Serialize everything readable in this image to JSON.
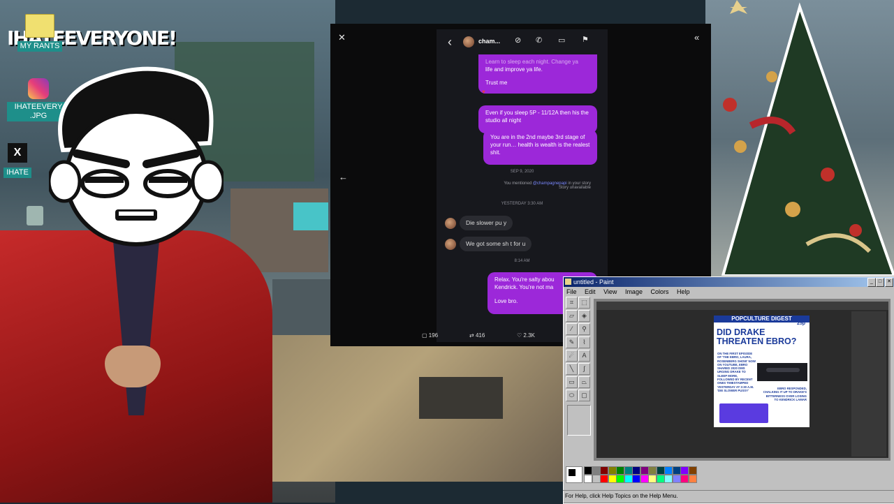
{
  "desktop": {
    "banner": "IHATEEVERYONE!",
    "icons": [
      {
        "label": "MY RANTS",
        "icon": "folder-icon"
      },
      {
        "label": "IHATEEVERY .JPG",
        "icon": "instagram-icon"
      },
      {
        "label": "IHATE",
        "icon": "x-icon"
      }
    ]
  },
  "chat": {
    "close_label": "✕",
    "collapse_label": "«",
    "back_arrow": "←",
    "header": {
      "name": "cham...",
      "back": "‹"
    },
    "messages": {
      "m1_line1": "Learn to sleep each night. Change ya",
      "m1_line2": "life and improve ya life.",
      "m1_line3": "Trust me",
      "m2": "Even if you sleep 5P - 11/12A then his the studio all night",
      "m3": "You are in the 2nd maybe 3rd stage of your run… health is wealth is the realest shit.",
      "date1": "SEP 9, 2020",
      "mention_prefix": "You mentioned",
      "mention_handle": "@champagnepapi",
      "mention_suffix": "in your story",
      "unavailable": "Story unavailable",
      "date2": "YESTERDAY 3:30 AM",
      "in1": "Die slower pu  y",
      "in2": "We got some sh t for u",
      "time3": "8:14 AM",
      "m4_line1": "Relax. You're salty abou",
      "m4_line2": "Kendrick. You're not ma",
      "m4_line3": "Love bro."
    },
    "stats": {
      "comments": "196",
      "reposts": "416",
      "likes": "2.3K"
    }
  },
  "paint": {
    "title": "untitled - Paint",
    "menu": [
      "File",
      "Edit",
      "View",
      "Image",
      "Colors",
      "Help"
    ],
    "status": "For Help, click Help Topics on the Help Menu.",
    "poster": {
      "masthead": "POPCULTURE DIGEST",
      "price": "25p",
      "headline": "DID DRAKE THREATEN EBRO?",
      "left_text": "ON THE FIRST EPISODE OF 'THE EBRO, LAURA, ROSENBERG SHOW' NOW ON YOUTUBE, EBRO SHARED 2020 DMS URGING DRAKE TO SLEEP MORE, FOLLOWED BY RECENT ONES TIMESTAMPED YESTERDAY AT 3:30 A.M. 'DIE SLOWER PUSSY'",
      "right_text": "EBRO RESPONDED, CHALKING IT UP TO DRAKE'S BITTERNESS OVER LOSING TO KENDRICK LAMAR"
    },
    "palette": [
      "#000000",
      "#808080",
      "#800000",
      "#808000",
      "#008000",
      "#008080",
      "#000080",
      "#800080",
      "#808040",
      "#004040",
      "#0080ff",
      "#004080",
      "#8000ff",
      "#804000",
      "#ffffff",
      "#c0c0c0",
      "#ff0000",
      "#ffff00",
      "#00ff00",
      "#00ffff",
      "#0000ff",
      "#ff00ff",
      "#ffff80",
      "#00ff80",
      "#80ffff",
      "#8080ff",
      "#ff0080",
      "#ff8040"
    ]
  },
  "colors": {
    "accent_purple": "#9c28d9",
    "paint_titlebar": "#0a246a"
  }
}
